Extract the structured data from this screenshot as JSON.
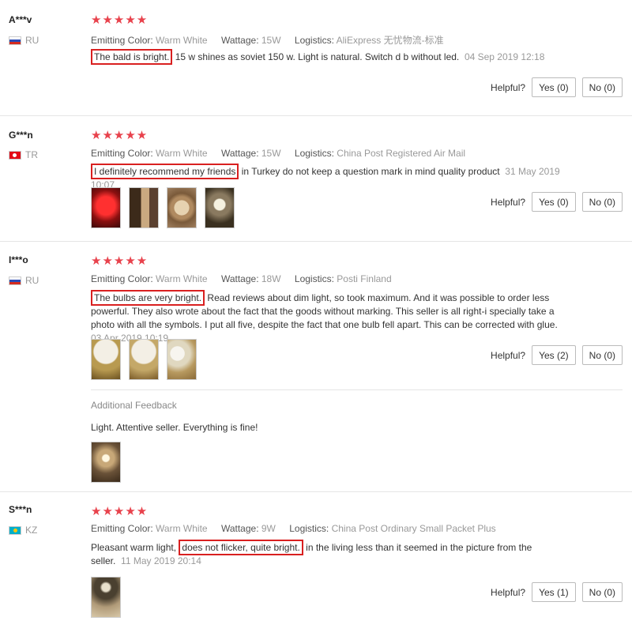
{
  "reviews": [
    {
      "user": "A***v",
      "country": "RU",
      "stars": "★★★★★",
      "color_label": "Emitting Color:",
      "color": "Warm White",
      "wattage_label": "Wattage:",
      "wattage": "15W",
      "logistics_label": "Logistics:",
      "logistics": "AliExpress 无忧物流-标准",
      "text_highlight": "The bald is bright.",
      "text_rest": " 15 w shines as soviet 150 w. Light is natural. Switch d b without led.",
      "date": "04 Sep 2019 12:18",
      "helpful_label": "Helpful?",
      "yes": "Yes (0)",
      "no": "No (0)"
    },
    {
      "user": "G***n",
      "country": "TR",
      "stars": "★★★★★",
      "color_label": "Emitting Color:",
      "color": "Warm White",
      "wattage_label": "Wattage:",
      "wattage": "15W",
      "logistics_label": "Logistics:",
      "logistics": "China Post Registered Air Mail",
      "text_highlight": "I definitely recommend my friends",
      "text_rest": " in Turkey do not keep a question mark in mind quality product",
      "date": "31 May 2019 10:07",
      "helpful_label": "Helpful?",
      "yes": "Yes (0)",
      "no": "No (0)"
    },
    {
      "user": "I***o",
      "country": "RU",
      "stars": "★★★★★",
      "color_label": "Emitting Color:",
      "color": "Warm White",
      "wattage_label": "Wattage:",
      "wattage": "18W",
      "logistics_label": "Logistics:",
      "logistics": "Posti Finland",
      "text_highlight": "The bulbs are very bright.",
      "text_rest": " Read reviews about dim light, so took maximum. And it was possible to order less powerful. They also wrote about the fact that the goods without marking. This seller is all right-i specially take a photo with all the symbols. I put all five, despite the fact that one bulb fell apart. This can be corrected with glue.",
      "date": "03 Apr 2019 10:19",
      "helpful_label": "Helpful?",
      "yes": "Yes (2)",
      "no": "No (0)",
      "additional_title": "Additional Feedback",
      "additional_text": "Light. Attentive seller. Everything is fine!"
    },
    {
      "user": "S***n",
      "country": "KZ",
      "stars": "★★★★★",
      "color_label": "Emitting Color:",
      "color": "Warm White",
      "wattage_label": "Wattage:",
      "wattage": "9W",
      "logistics_label": "Logistics:",
      "logistics": "China Post Ordinary Small Packet Plus",
      "text_pre": "Pleasant warm light,",
      "text_highlight": "does not flicker, quite bright.",
      "text_rest": " in the living less than it seemed in the picture from the seller.",
      "date": "11 May 2019 20:14",
      "helpful_label": "Helpful?",
      "yes": "Yes (1)",
      "no": "No (0)"
    }
  ],
  "colors": {
    "star": "#e8424c",
    "highlight_border": "#d92020",
    "meta_gray": "#999999"
  },
  "icons": [
    "star-icon",
    "flag-ru-icon",
    "flag-tr-icon",
    "flag-kz-icon"
  ]
}
